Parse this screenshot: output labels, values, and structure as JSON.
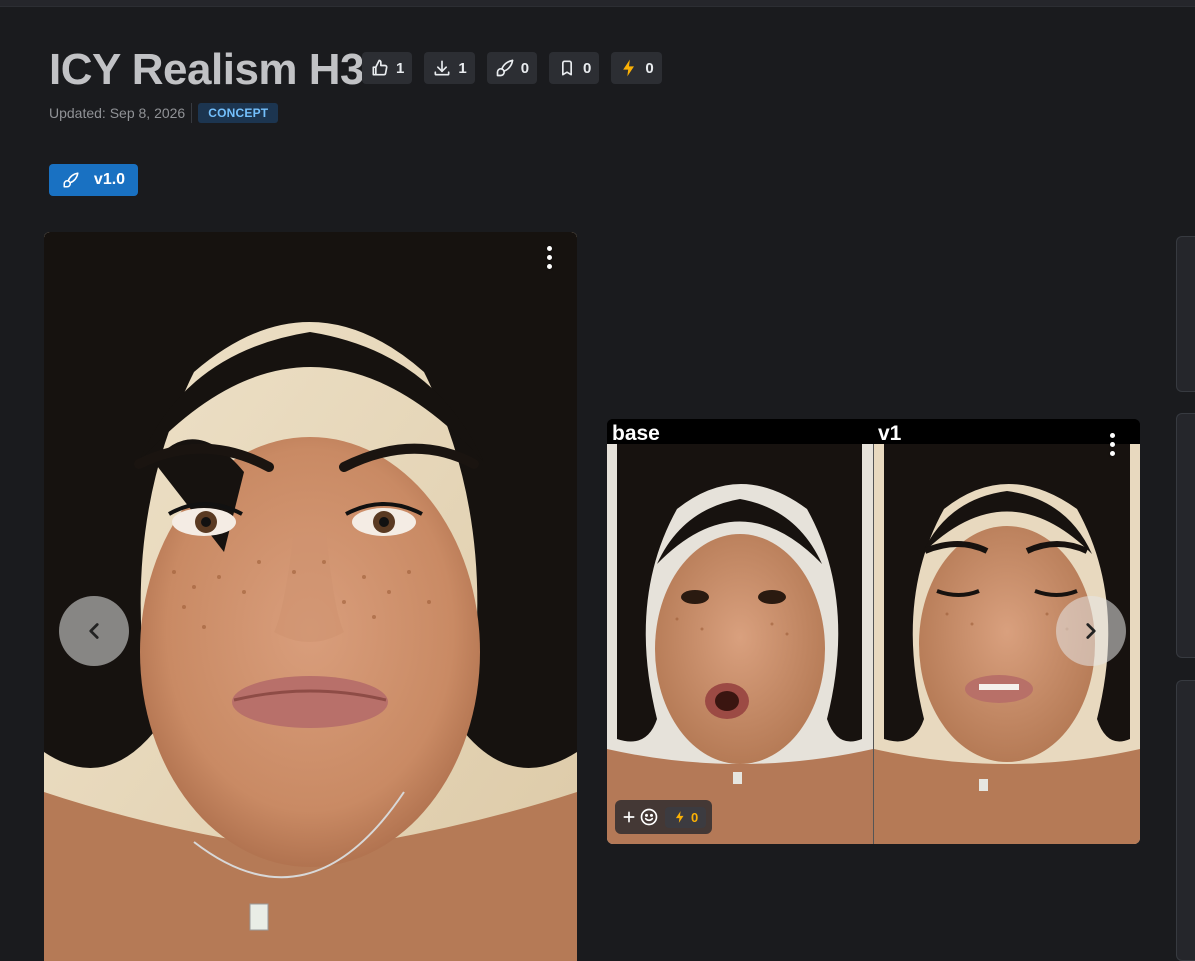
{
  "header": {
    "title": "ICY Realism H3",
    "updated": "Updated: Sep 8, 2026",
    "badge": "CONCEPT"
  },
  "stats": [
    {
      "icon": "thumbs-up-icon",
      "value": "1"
    },
    {
      "icon": "download-icon",
      "value": "1"
    },
    {
      "icon": "brush-icon",
      "value": "0"
    },
    {
      "icon": "bookmark-icon",
      "value": "0"
    },
    {
      "icon": "bolt-icon",
      "value": "0"
    }
  ],
  "version": {
    "label": "v1.0"
  },
  "gallery": {
    "comparison_labels": {
      "left": "base",
      "right": "v1"
    },
    "buzz_count": "0"
  },
  "colors": {
    "background": "#1a1b1e",
    "accent": "#1971c2",
    "badge_bg": "#1c3550",
    "badge_text": "#74c0fc",
    "bolt": "#fab005"
  }
}
